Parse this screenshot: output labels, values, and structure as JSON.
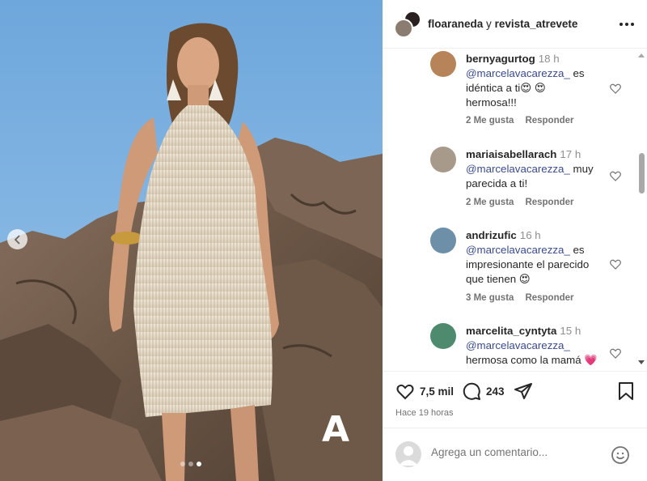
{
  "post": {
    "image_alt": "Mujer con vestido de flecos sobre rocas",
    "watermark": "A",
    "carousel": {
      "count": 3,
      "active": 3
    }
  },
  "header": {
    "user1": "floaraneda",
    "joiner": "y",
    "user2": "revista_atrevete"
  },
  "comments": [
    {
      "user": "bernyagurtog",
      "time": "18 h",
      "mention": "@marcelavacarezza_",
      "text": " es idéntica a ti😍 😍 hermosa!!!",
      "likes": "2 Me gusta",
      "reply": "Responder"
    },
    {
      "user": "mariaisabellarach",
      "time": "17 h",
      "mention": "@marcelavacarezza_",
      "text": " muy parecida a ti!",
      "likes": "2 Me gusta",
      "reply": "Responder"
    },
    {
      "user": "andrizufic",
      "time": "16 h",
      "mention": "@marcelavacarezza_",
      "text": " es impresionante el parecido que tienen 😍",
      "likes": "3 Me gusta",
      "reply": "Responder"
    },
    {
      "user": "marcelita_cyntyta",
      "time": "15 h",
      "mention": "@marcelavacarezza_",
      "text": " hermosa como la mamá 💗",
      "likes": "",
      "reply": ""
    }
  ],
  "actions": {
    "likes": "7,5 mil",
    "comments": "243",
    "time_ago": "Hace 19 horas"
  },
  "add_comment": {
    "placeholder": "Agrega un comentario..."
  },
  "colors": {
    "mention": "#3a4b8c",
    "heart_emoji": "#e0245e"
  }
}
